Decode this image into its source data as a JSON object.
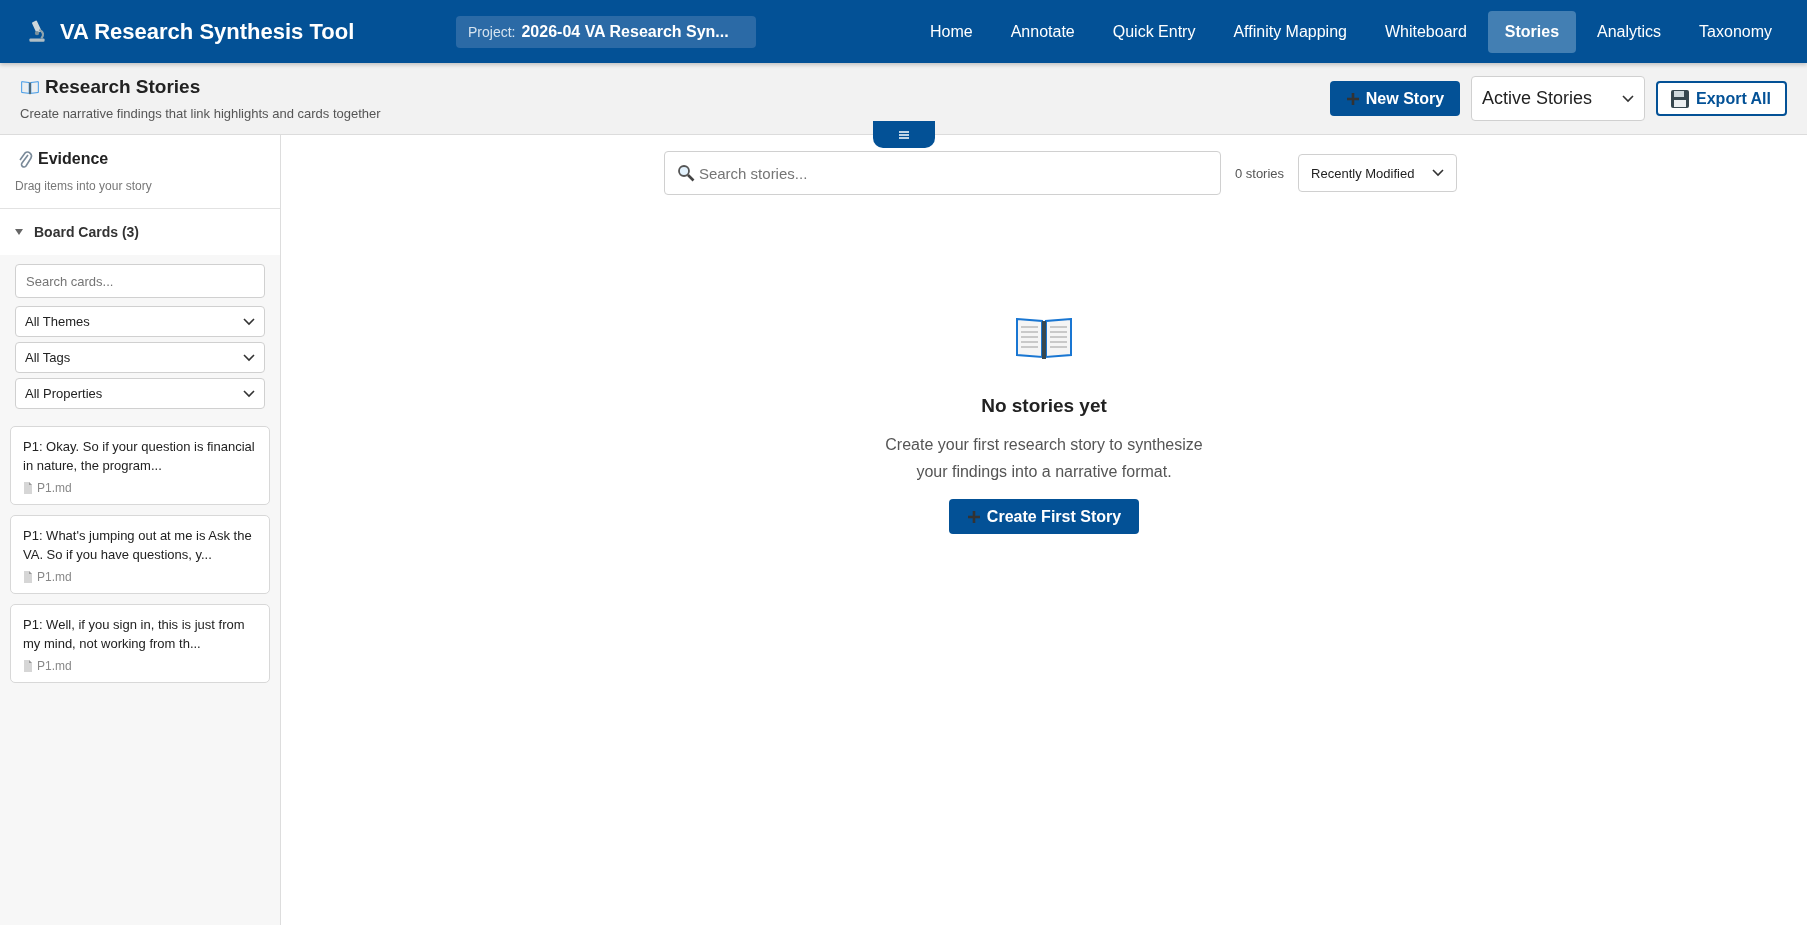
{
  "header": {
    "title": "VA Research Synthesis Tool",
    "project": {
      "label": "Project:",
      "value": "2026-04 VA Research Syn..."
    },
    "nav": [
      {
        "label": "Home",
        "selected": false
      },
      {
        "label": "Annotate",
        "selected": false
      },
      {
        "label": "Quick Entry",
        "selected": false
      },
      {
        "label": "Affinity Mapping",
        "selected": false
      },
      {
        "label": "Whiteboard",
        "selected": false
      },
      {
        "label": "Stories",
        "selected": true
      },
      {
        "label": "Analytics",
        "selected": false
      },
      {
        "label": "Taxonomy",
        "selected": false
      }
    ]
  },
  "page": {
    "title": "Research Stories",
    "subtitle": "Create narrative findings that link highlights and cards together",
    "new_button": "New Story",
    "filter": "Active Stories",
    "export_button": "Export All"
  },
  "sidebar": {
    "title": "Evidence",
    "hint": "Drag items into your story",
    "section": {
      "label": "Board Cards (3)",
      "expanded": true,
      "search": {
        "placeholder": "Search cards..."
      },
      "filters": [
        "All Themes",
        "All Tags",
        "All Properties"
      ],
      "cards": [
        {
          "text": "P1: Okay. So if your question is financial in nature, the program...",
          "source": "P1.md"
        },
        {
          "text": "P1: What's jumping out at me is Ask the VA. So if you have questions, y...",
          "source": "P1.md"
        },
        {
          "text": "P1: Well, if you sign in, this is just from my mind, not working from th...",
          "source": "P1.md"
        }
      ]
    }
  },
  "main": {
    "search": {
      "placeholder": "Search stories..."
    },
    "count": "0 stories",
    "sort": "Recently Modified",
    "empty": {
      "title": "No stories yet",
      "text": "Create your first research story to synthesize your findings into a narrative format.",
      "button": "Create First Story"
    }
  }
}
